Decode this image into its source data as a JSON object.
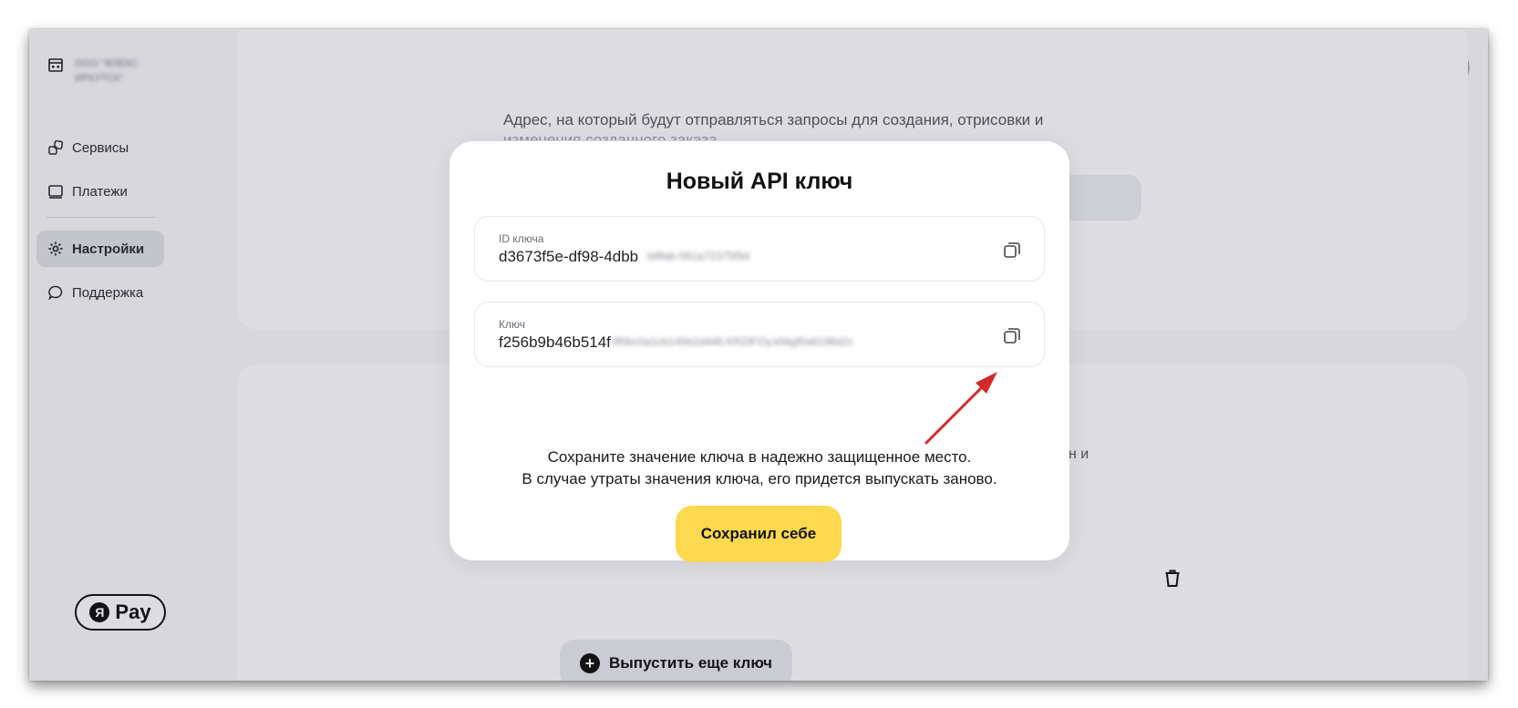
{
  "header": {
    "org_name_line1": "ООО \"ФЛЕКС",
    "org_name_line2": "ИРКУТСК\"",
    "icons": [
      "bell-icon",
      "help-icon",
      "avatar",
      "kebab-icon"
    ]
  },
  "sidebar": {
    "items": [
      {
        "label": "Сервисы",
        "icon": "services-icon"
      },
      {
        "label": "Платежи",
        "icon": "payments-icon"
      },
      {
        "label": "Настройки",
        "icon": "gear-icon",
        "active": true
      },
      {
        "label": "Поддержка",
        "icon": "chat-icon"
      }
    ],
    "brand_letter": "Я",
    "brand_pay": "Pay"
  },
  "background": {
    "card1_text": "Адрес, на который будут отправляться запросы для создания, отрисовки и",
    "card1_faded": "изменения созданного заказа",
    "card2_stray": "н и",
    "issue_button": "Выпустить еще ключ"
  },
  "modal": {
    "title": "Новый API ключ",
    "id_field": {
      "label": "ID ключа",
      "value": "d3673f5e-df98-4dbb",
      "blurred": "-b9fab-561a72375f9d"
    },
    "key_field": {
      "label": "Ключ",
      "value": "f256b9b46b514f",
      "blurred": "0f0bc0a1cb145b2d446.KRZtFOy.kNtgf0a6198d2c"
    },
    "notice_line1": "Сохраните значение ключа в надежно защищенное место.",
    "notice_line2": "В случае утраты значения ключа, его придется выпускать заново.",
    "save_button": "Сохранил себе"
  },
  "colors": {
    "accent_yellow": "#fcd94e",
    "annotation_arrow": "#d42a2a",
    "backdrop": "#efeff3"
  }
}
